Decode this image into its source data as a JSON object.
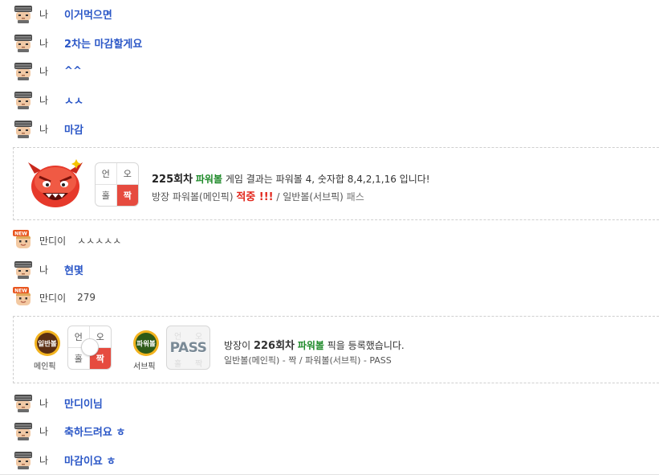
{
  "messages_top": [
    {
      "nick": "나",
      "text": "이거먹으면"
    },
    {
      "nick": "나",
      "text": "2차는 마감할게요"
    },
    {
      "nick": "나",
      "text": "^^"
    },
    {
      "nick": "나",
      "text": "ㅅㅅ"
    },
    {
      "nick": "나",
      "text": "마감"
    }
  ],
  "result_card": {
    "grid": {
      "tl": "언",
      "tr": "오",
      "bl": "홀",
      "br": "짝"
    },
    "round": "225회차",
    "game": "파워볼",
    "line1_rest": " 게임 결과는 파워볼 4, 숫자합 8,4,2,1,16 입니다!",
    "line2_prefix": "방장 파워볼(메인픽) ",
    "hit": "적중 !!!",
    "line2_mid": " / 일반볼(서브픽) ",
    "line2_pass": "패스"
  },
  "messages_mid": [
    {
      "nick": "만디이",
      "text": "ㅅㅅㅅㅅㅅ",
      "badge": "NEW"
    },
    {
      "nick": "나",
      "text": "현몇"
    },
    {
      "nick": "만디이",
      "text": "279",
      "badge": "NEW"
    }
  ],
  "pick_card": {
    "main_badge": "일반볼",
    "main_label": "메인픽",
    "grid": {
      "tl": "언",
      "tr": "오",
      "bl": "홀",
      "br": "짝"
    },
    "sub_badge": "파워볼",
    "sub_label": "서브픽",
    "pass_text": "PASS",
    "pass_faint": {
      "tl": "언",
      "tr": "오",
      "bl": "홀",
      "br": "짝"
    },
    "line1_prefix": "방장이 ",
    "round": "226회차",
    "game": "파워볼",
    "line1_suffix": " 픽을 등록했습니다.",
    "line2": "일반볼(메인픽) - 짝 / 파워볼(서브픽) - PASS"
  },
  "messages_bottom": [
    {
      "nick": "나",
      "text": "만디이님"
    },
    {
      "nick": "나",
      "text": "축하드려요 ㅎ"
    },
    {
      "nick": "나",
      "text": "마감이요 ㅎ"
    }
  ],
  "colors": {
    "my_message": "#2b57c7",
    "green": "#1f8a2a",
    "red": "#e64b3f",
    "hit": "#e2261c"
  },
  "icons": {
    "me_avatar": "helmet-soldier-avatar-icon",
    "other_avatar": "new-user-avatar-icon",
    "result_emoji": "red-devil-emoji-icon",
    "main_badge": "general-ball-badge-icon",
    "sub_badge": "powerball-badge-icon"
  }
}
